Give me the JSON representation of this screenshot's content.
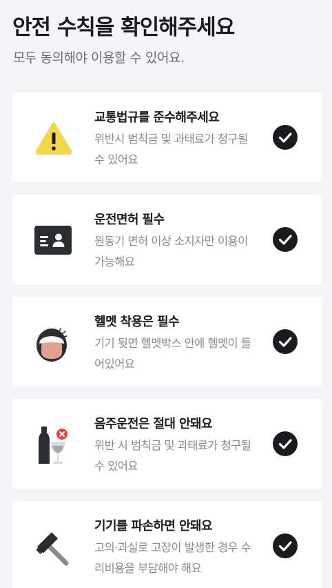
{
  "header": {
    "title": "안전 수칙을 확인해주세요",
    "subtitle": "모두 동의해야 이용할 수 있어요."
  },
  "rules": [
    {
      "title": "교통법규를 준수해주세요",
      "description": "위반시 범칙금 및 과태료가 청구될 수 있어요",
      "icon": "warning-triangle-icon",
      "checked": true
    },
    {
      "title": "운전면허 필수",
      "description": "원동기 면허 이상 소지자만 이용이 가능해요",
      "icon": "license-card-icon",
      "checked": true
    },
    {
      "title": "헬멧 착용은 필수",
      "description": "기기 뒷면 헬멧박스 안에 헬멧이 들어있어요",
      "icon": "helmet-person-icon",
      "checked": true
    },
    {
      "title": "음주운전은 절대 안돼요",
      "description": "위반 시 범칙금 및 과태료가 청구될 수 있어요",
      "icon": "no-alcohol-icon",
      "checked": true
    },
    {
      "title": "기기를 파손하면 안돼요",
      "description": "고의·과실로 고장이 발생한 경우 수리비용을 부담해야 해요",
      "icon": "hammer-icon",
      "checked": true
    }
  ],
  "colors": {
    "background": "#f5f5f7",
    "card": "#ffffff",
    "check": "#1b1b1f",
    "warning": "#f2d64b",
    "skin": "#e2a090",
    "danger": "#e0453a"
  }
}
